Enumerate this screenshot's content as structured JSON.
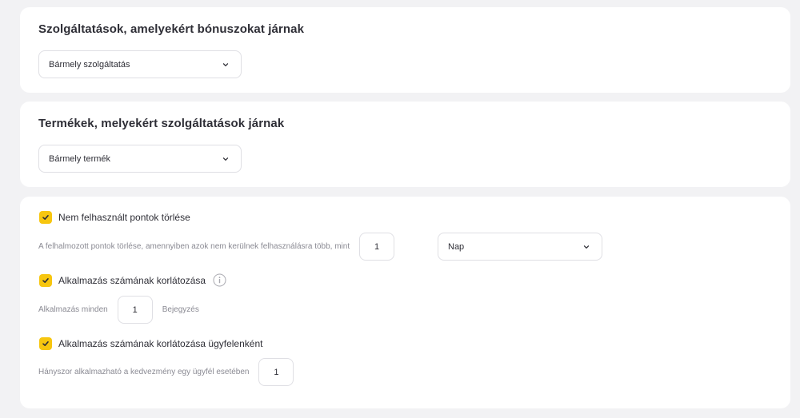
{
  "services_section": {
    "title": "Szolgáltatások, amelyekért bónuszokat járnak",
    "select_value": "Bármely szolgáltatás"
  },
  "products_section": {
    "title": "Termékek, melyekért szolgáltatások járnak",
    "select_value": "Bármely termék"
  },
  "settings": {
    "delete_points": {
      "label": "Nem felhasznált pontok törlése",
      "description": "A felhalmozott pontok törlése, amennyiben azok nem kerülnek felhasználásra több, mint",
      "value": "1",
      "unit_select": "Nap"
    },
    "limit_usage": {
      "label": "Alkalmazás számának korlátozása",
      "prefix": "Alkalmazás minden",
      "value": "1",
      "suffix": "Bejegyzés"
    },
    "limit_per_customer": {
      "label": "Alkalmazás számának korlátozása ügyfelenként",
      "description": "Hányszor alkalmazható a kedvezmény egy ügyfél esetében",
      "value": "1"
    }
  },
  "colors": {
    "accent": "#f7c60f",
    "background": "#f2f2f4",
    "card": "#ffffff"
  },
  "icons": {
    "dropdown": "chevron-down-icon",
    "checkbox": "check-icon",
    "info": "info-icon"
  }
}
